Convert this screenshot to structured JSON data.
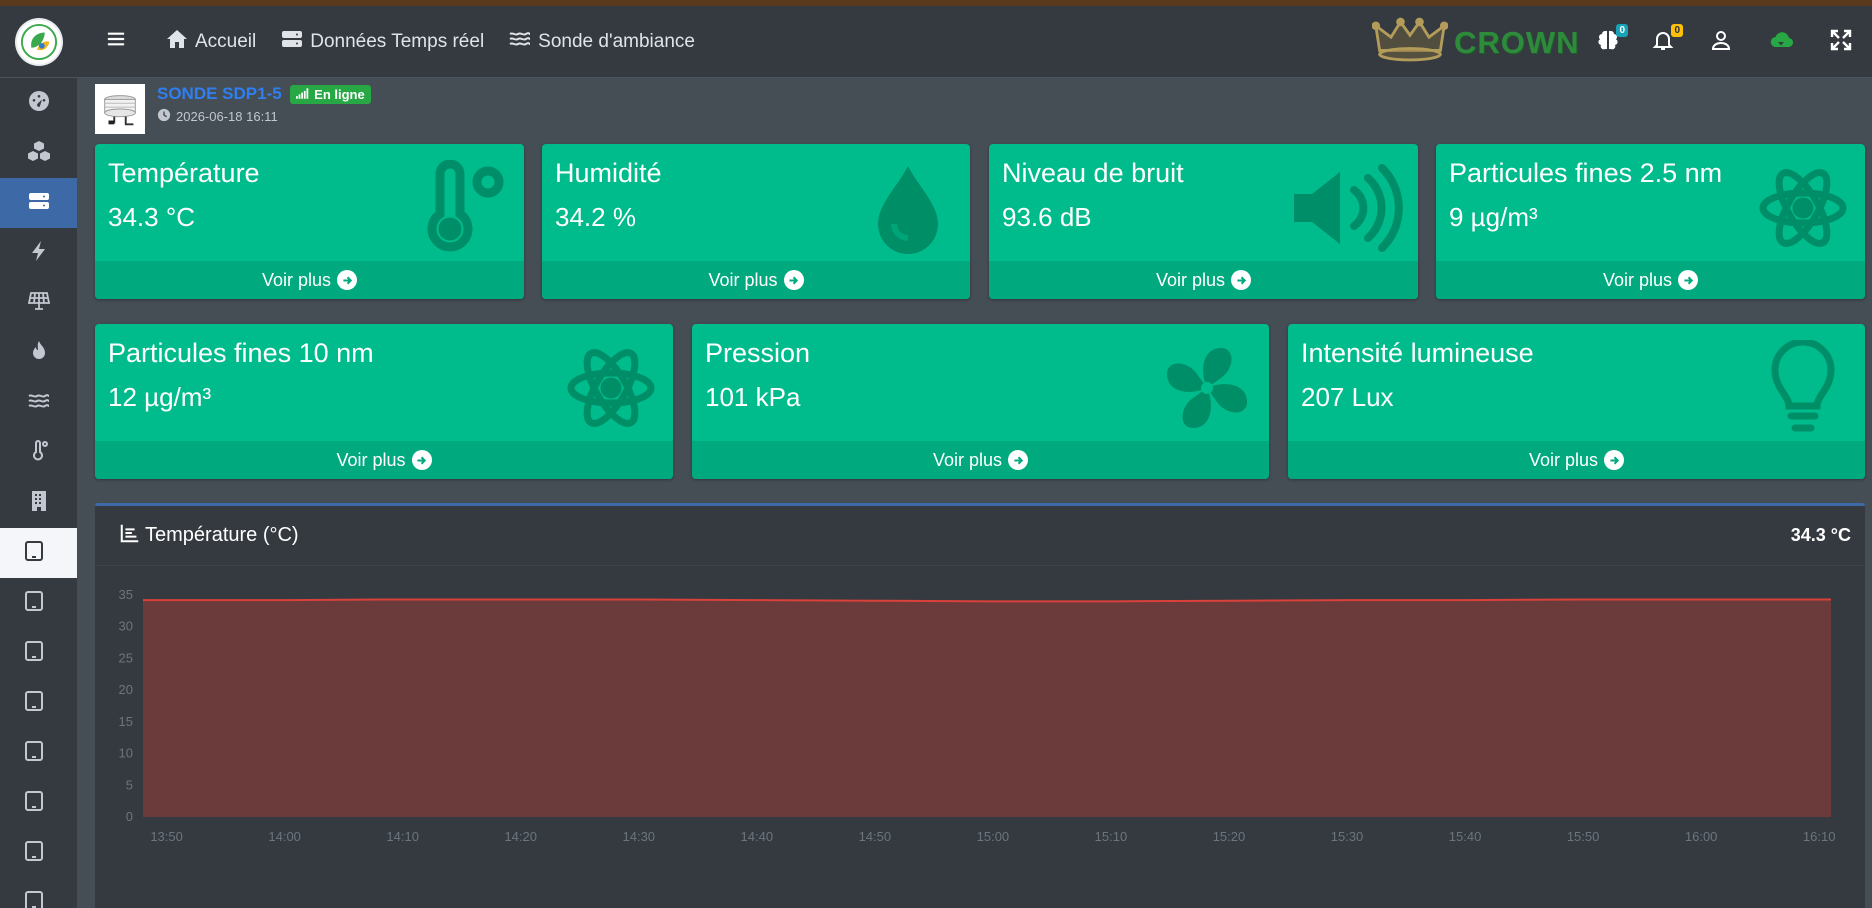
{
  "nav": {
    "home": "Accueil",
    "realtime": "Données Temps réel",
    "probe": "Sonde d'ambiance",
    "brand": "CROWN",
    "badge_a": "0",
    "badge_b": "0"
  },
  "device": {
    "name": "SONDE SDP1-5",
    "status": "En ligne",
    "timestamp": "2026-06-18 16:11"
  },
  "cards": [
    {
      "title": "Température",
      "value": "34.3 °C",
      "more": "Voir plus",
      "icon": "thermometer-icon"
    },
    {
      "title": "Humidité",
      "value": "34.2 %",
      "more": "Voir plus",
      "icon": "droplet-icon"
    },
    {
      "title": "Niveau de bruit",
      "value": "93.6 dB",
      "more": "Voir plus",
      "icon": "speaker-icon"
    },
    {
      "title": "Particules fines 2.5 nm",
      "value": "9 µg/m³",
      "more": "Voir plus",
      "icon": "atom-icon"
    },
    {
      "title": "Particules fines 10 nm",
      "value": "12 µg/m³",
      "more": "Voir plus",
      "icon": "atom-icon"
    },
    {
      "title": "Pression",
      "value": "101 kPa",
      "more": "Voir plus",
      "icon": "fan-icon"
    },
    {
      "title": "Intensité lumineuse",
      "value": "207 Lux",
      "more": "Voir plus",
      "icon": "lightbulb-icon"
    }
  ],
  "panel": {
    "title": "Température (°C)",
    "value": "34.3 °C"
  },
  "colors": {
    "card": "#00bc8c",
    "card_footer": "#00a97e",
    "series_fill": "#6b3a3a",
    "series_line": "#d9413a"
  },
  "chart_data": {
    "type": "area",
    "ylim": [
      0,
      35
    ],
    "yticks": [
      0,
      5,
      10,
      15,
      20,
      25,
      30,
      35
    ],
    "categories": [
      "13:50",
      "14:00",
      "14:10",
      "14:20",
      "14:30",
      "14:40",
      "14:50",
      "15:00",
      "15:10",
      "15:20",
      "15:30",
      "15:40",
      "15:50",
      "16:00",
      "16:10"
    ],
    "x": [
      "13:48",
      "13:50",
      "14:00",
      "14:10",
      "14:20",
      "14:30",
      "14:40",
      "14:50",
      "15:00",
      "15:10",
      "15:20",
      "15:30",
      "15:40",
      "15:50",
      "16:00",
      "16:10",
      "16:11"
    ],
    "values": [
      34.2,
      34.2,
      34.2,
      34.3,
      34.3,
      34.3,
      34.2,
      34.1,
      34.0,
      34.0,
      34.1,
      34.2,
      34.2,
      34.3,
      34.3,
      34.3,
      34.3
    ],
    "grid": false
  }
}
